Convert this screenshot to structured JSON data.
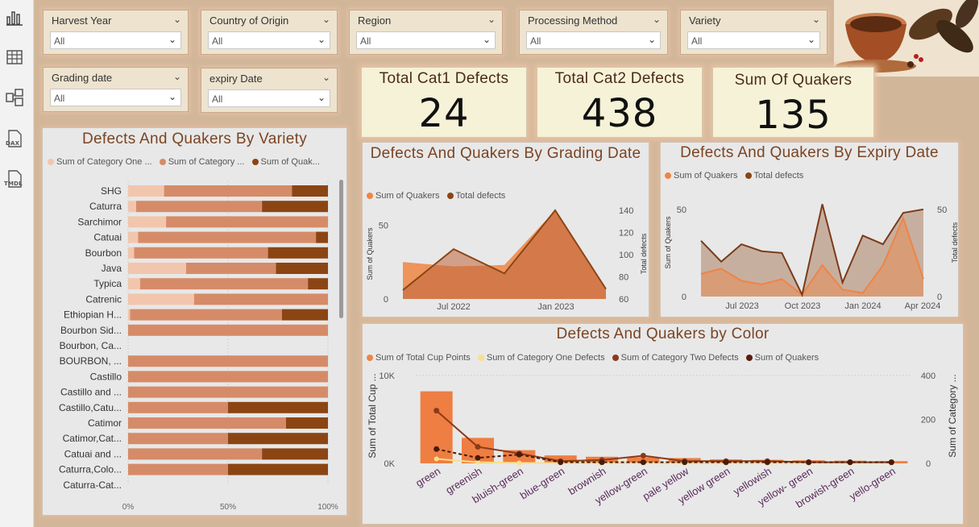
{
  "rail": {
    "icons": [
      "report-view-icon",
      "table-view-icon",
      "model-view-icon",
      "dax-query-icon",
      "tmdl-view-icon"
    ],
    "dax_label": "DAX",
    "tmdl_label": "TMDL"
  },
  "slicers": [
    {
      "label": "Harvest Year",
      "value": "All"
    },
    {
      "label": "Country of Origin",
      "value": "All"
    },
    {
      "label": "Region",
      "value": "All"
    },
    {
      "label": "Processing Method",
      "value": "All"
    },
    {
      "label": "Variety",
      "value": "All"
    },
    {
      "label": "Grading date",
      "value": "All"
    },
    {
      "label": "expiry Date",
      "value": "All"
    }
  ],
  "kpis": [
    {
      "title": "Total Cat1 Defects",
      "value": "24"
    },
    {
      "title": "Total Cat2 Defects",
      "value": "438"
    },
    {
      "title": "Sum Of Quakers",
      "value": "135"
    }
  ],
  "colors": {
    "light": "#f2c6ad",
    "mid": "#d68b68",
    "dark": "#8b4513",
    "orange": "#ee8544",
    "cream": "#f6e08a",
    "darkbrown": "#6b2d14"
  },
  "chart_data": [
    {
      "type": "bar",
      "title": "Defects And Quakers By Variety",
      "stacked": "100%",
      "legend": [
        "Sum of Category One ...",
        "Sum of Category ...",
        "Sum of Quak..."
      ],
      "categories": [
        "SHG",
        "Caturra",
        "Sarchimor",
        "Catuai",
        "Bourbon",
        "Java",
        "Typica",
        "Catrenic",
        "Ethiopian H...",
        "Bourbon Sid...",
        "Bourbon, Ca...",
        "BOURBON, ...",
        "Castillo",
        "Castillo and ...",
        "Castillo,Catu...",
        "Catimor",
        "Catimor,Cat...",
        "Catuai and ...",
        "Caturra,Colo...",
        "Caturra-Cat..."
      ],
      "series": [
        {
          "name": "Sum of Category One ...",
          "values": [
            18,
            4,
            19,
            5,
            3,
            29,
            6,
            33,
            1,
            0,
            0,
            0,
            0,
            0,
            0,
            0,
            0,
            0,
            0,
            0
          ]
        },
        {
          "name": "Sum of Category ...",
          "values": [
            64,
            63,
            81,
            89,
            67,
            45,
            84,
            67,
            76,
            100,
            0,
            100,
            100,
            100,
            50,
            79,
            50,
            67,
            50,
            0
          ]
        },
        {
          "name": "Sum of Quak...",
          "values": [
            18,
            33,
            0,
            6,
            30,
            26,
            10,
            0,
            23,
            0,
            0,
            0,
            0,
            0,
            50,
            21,
            50,
            33,
            50,
            0
          ]
        }
      ],
      "xticks": [
        "0%",
        "50%",
        "100%"
      ]
    },
    {
      "type": "area",
      "title": "Defects And Quakers By Grading Date",
      "legend": [
        "Sum of Quakers",
        "Total defects"
      ],
      "x": [
        "2022-04",
        "2022-07",
        "2022-10",
        "2023-01",
        "2023-04"
      ],
      "xticks": [
        "Jul 2022",
        "Jan 2023"
      ],
      "series": [
        {
          "name": "Sum of Quakers",
          "values": [
            25,
            22,
            23,
            60,
            6
          ]
        },
        {
          "name": "Total defects",
          "values": [
            68,
            105,
            83,
            140,
            69
          ]
        }
      ],
      "ylabel": "Sum of Quakers",
      "y2label": "Total defects",
      "yticks": [
        "0",
        "50"
      ],
      "y2ticks": [
        "140",
        "120",
        "100",
        "80",
        "60"
      ]
    },
    {
      "type": "area",
      "title": "Defects And Quakers By Expiry Date",
      "legend": [
        "Sum of Quakers",
        "Total defects"
      ],
      "xticks": [
        "Jul 2023",
        "Oct 2023",
        "Jan 2024",
        "Apr 2024"
      ],
      "series": [
        {
          "name": "Sum of Quakers",
          "values": [
            13,
            16,
            9,
            7,
            10,
            1,
            18,
            4,
            2,
            18,
            45,
            10
          ]
        },
        {
          "name": "Total defects",
          "values": [
            32,
            20,
            30,
            26,
            25,
            1,
            53,
            8,
            35,
            30,
            48,
            50
          ]
        }
      ],
      "ylabel": "Sum of Quakers",
      "y2label": "Total defects",
      "yticks": [
        "0",
        "50"
      ],
      "y2ticks": [
        "0",
        "50"
      ]
    },
    {
      "type": "bar",
      "title": "Defects And Quakers by Color",
      "legend": [
        "Sum of Total Cup Points",
        "Sum of Category One Defects",
        "Sum of Category Two Defects",
        "Sum of Quakers"
      ],
      "categories": [
        "green",
        "greenish",
        "bluish-green",
        "blue-green",
        "brownish",
        "yellow-green",
        "pale yellow",
        "yellow green",
        "yellowish",
        "yellow- green",
        "browish-green",
        "yello-green"
      ],
      "series": [
        {
          "name": "Sum of Total Cup Points",
          "values": [
            8200,
            2900,
            1500,
            900,
            750,
            700,
            600,
            450,
            400,
            350,
            300,
            250
          ]
        },
        {
          "name": "Sum of Category One Defects",
          "values": [
            20,
            5,
            2,
            1,
            1,
            1,
            0,
            0,
            0,
            0,
            0,
            0
          ]
        },
        {
          "name": "Sum of Category Two Defects",
          "values": [
            240,
            75,
            45,
            10,
            15,
            35,
            10,
            10,
            10,
            5,
            5,
            5
          ]
        },
        {
          "name": "Sum of Quakers",
          "values": [
            65,
            25,
            40,
            5,
            5,
            5,
            5,
            5,
            5,
            5,
            5,
            5
          ]
        }
      ],
      "ylabel": "Sum of Total Cup ...",
      "y2label": "Sum of Category ...",
      "yticks": [
        "10K",
        "0K"
      ],
      "y2ticks": [
        "400",
        "200",
        "0"
      ]
    }
  ]
}
